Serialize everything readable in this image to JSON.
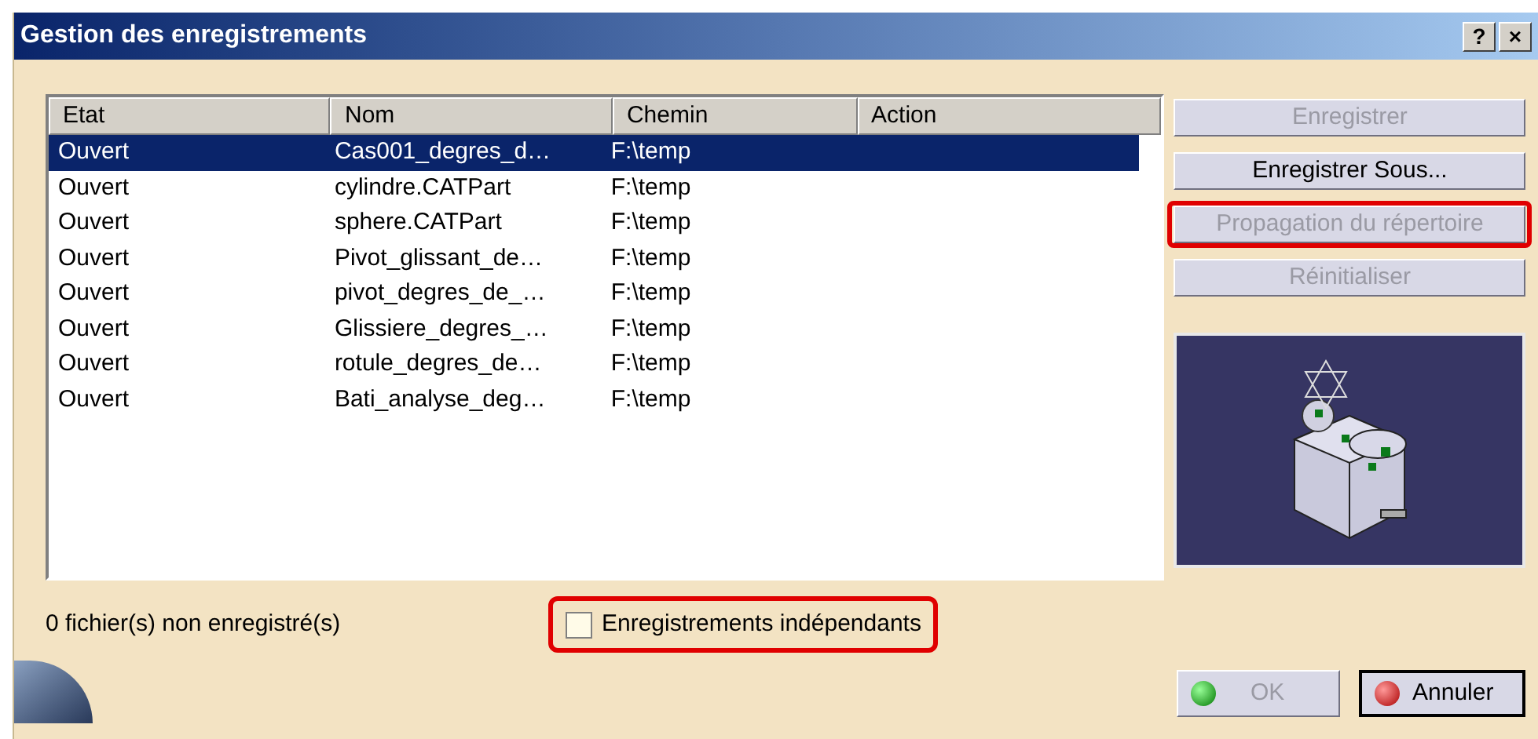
{
  "window": {
    "title": "Gestion des enregistrements",
    "title_buttons": [
      "?",
      "×"
    ]
  },
  "table": {
    "columns": [
      "Etat",
      "Nom",
      "Chemin",
      "Action"
    ],
    "rows": [
      {
        "cells": [
          "Ouvert",
          "Cas001_degres_d…",
          "F:\\temp",
          ""
        ],
        "selected": true
      },
      {
        "cells": [
          "Ouvert",
          "cylindre.CATPart",
          "F:\\temp",
          ""
        ],
        "selected": false
      },
      {
        "cells": [
          "Ouvert",
          "sphere.CATPart",
          "F:\\temp",
          ""
        ],
        "selected": false
      },
      {
        "cells": [
          "Ouvert",
          "Pivot_glissant_de…",
          "F:\\temp",
          ""
        ],
        "selected": false
      },
      {
        "cells": [
          "Ouvert",
          "pivot_degres_de_…",
          "F:\\temp",
          ""
        ],
        "selected": false
      },
      {
        "cells": [
          "Ouvert",
          "Glissiere_degres_…",
          "F:\\temp",
          ""
        ],
        "selected": false
      },
      {
        "cells": [
          "Ouvert",
          "rotule_degres_de…",
          "F:\\temp",
          ""
        ],
        "selected": false
      },
      {
        "cells": [
          "Ouvert",
          "Bati_analyse_deg…",
          "F:\\temp",
          ""
        ],
        "selected": false
      }
    ]
  },
  "side_buttons": [
    {
      "label": "Enregistrer",
      "disabled": true,
      "highlighted": false
    },
    {
      "label": "Enregistrer Sous...",
      "disabled": false,
      "highlighted": false
    },
    {
      "label": "Propagation du répertoire",
      "disabled": true,
      "highlighted": true
    },
    {
      "label": "Réinitialiser",
      "disabled": true,
      "highlighted": false
    }
  ],
  "status": "0 fichier(s) non enregistré(s)",
  "independent_checkbox": {
    "label": "Enregistrements indépendants",
    "checked": false,
    "highlighted": true
  },
  "footer_buttons": [
    {
      "label": "OK",
      "kind": "ok",
      "disabled": true
    },
    {
      "label": "Annuler",
      "kind": "cancel",
      "disabled": false
    }
  ]
}
